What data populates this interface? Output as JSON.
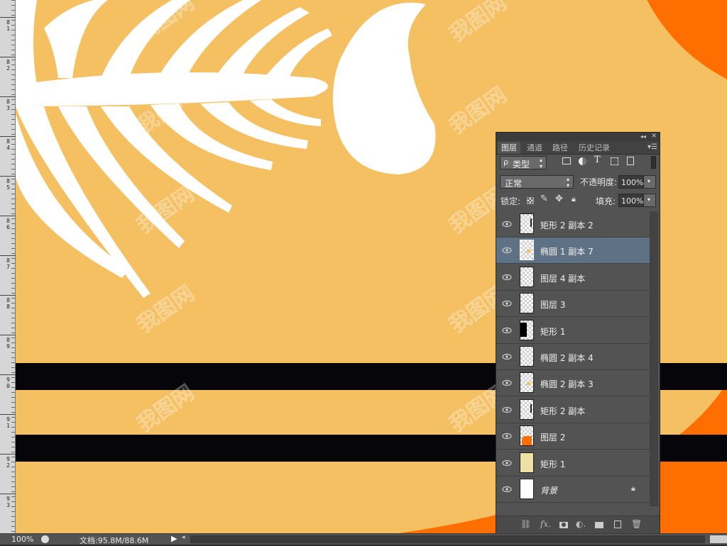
{
  "ruler": {
    "labels": [
      "81",
      "82",
      "83",
      "84",
      "85",
      "86",
      "87",
      "88",
      "89",
      "90",
      "91",
      "92",
      "93"
    ]
  },
  "canvas": {
    "background_color": "#f4c062",
    "accent_orange": "#ff6e00",
    "stripe_color": "#06060a",
    "bone_color": "#ffffff",
    "watermark_text": "我图网"
  },
  "panel": {
    "header_buttons": {
      "collapse": "◂◂",
      "close": "×"
    },
    "tabs": [
      "图层",
      "通道",
      "路径",
      "历史记录"
    ],
    "filter": {
      "search_glyph": "ρ",
      "value": "类型"
    },
    "filter_icons": [
      "image-filter-icon",
      "adjustment-filter-icon",
      "type-filter-icon",
      "shape-filter-icon",
      "smart-object-filter-icon"
    ],
    "blend_mode": "正常",
    "opacity_label": "不透明度:",
    "opacity_value": "100%",
    "lock_label": "锁定:",
    "fill_label": "填充:",
    "fill_value": "100%",
    "layers": [
      {
        "name": "矩形 2 副本 2",
        "selected": false,
        "thumb": "transparent-small-mark"
      },
      {
        "name": "椭圆 1 副本 7",
        "selected": true,
        "thumb": "transparent-orange-dot"
      },
      {
        "name": "图层 4 副本",
        "selected": false,
        "thumb": "transparent"
      },
      {
        "name": "图层 3",
        "selected": false,
        "thumb": "transparent"
      },
      {
        "name": "矩形 1",
        "selected": false,
        "thumb": "black-rect"
      },
      {
        "name": "椭圆 2 副本 4",
        "selected": false,
        "thumb": "transparent"
      },
      {
        "name": "椭圆 2 副本 3",
        "selected": false,
        "thumb": "transparent-orange-dot"
      },
      {
        "name": "矩形 2 副本",
        "selected": false,
        "thumb": "transparent-small-mark"
      },
      {
        "name": "图层 2",
        "selected": false,
        "thumb": "orange-shape"
      },
      {
        "name": "矩形 1",
        "selected": false,
        "thumb": "cream"
      },
      {
        "name": "背景",
        "selected": false,
        "thumb": "white",
        "locked": true
      }
    ],
    "bottom_icons": [
      "link-icon",
      "fx-icon",
      "mask-icon",
      "adjustment-icon",
      "folder-icon",
      "new-layer-icon",
      "trash-icon"
    ]
  },
  "status": {
    "zoom": "100%",
    "doc_info": "文档:95.8M/88.6M"
  }
}
